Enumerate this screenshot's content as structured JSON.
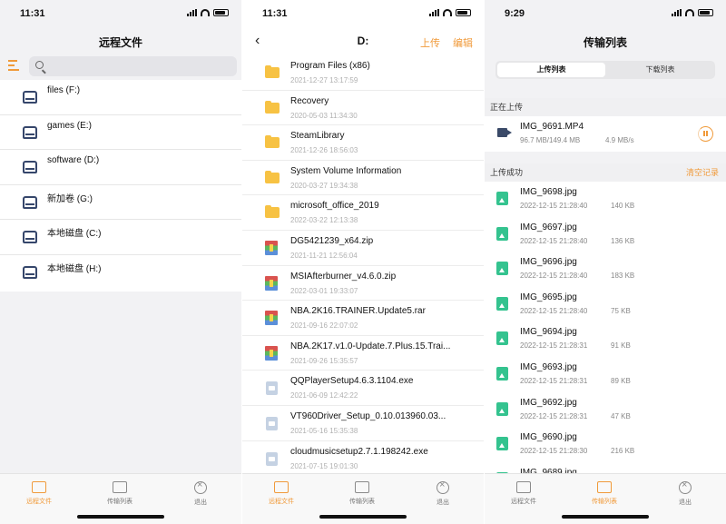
{
  "screen1": {
    "time": "11:31",
    "title": "远程文件",
    "drives": [
      {
        "label": "files (F:)"
      },
      {
        "label": "games (E:)"
      },
      {
        "label": "software (D:)"
      },
      {
        "label": "新加卷 (G:)"
      },
      {
        "label": "本地磁盘 (C:)"
      },
      {
        "label": "本地磁盘 (H:)"
      }
    ],
    "tabs": [
      "远程文件",
      "传输列表",
      "退出"
    ],
    "active_tab": "远程文件"
  },
  "screen2": {
    "time": "11:31",
    "title": "D:",
    "upload_action": "上传",
    "edit_action": "编辑",
    "files": [
      {
        "name": "Program Files (x86)",
        "date": "2021-12-27 13:17:59",
        "icon": "folder-icon"
      },
      {
        "name": "Recovery",
        "date": "2020-05-03 11:34:30",
        "icon": "folder-icon"
      },
      {
        "name": "SteamLibrary",
        "date": "2021-12-26 18:56:03",
        "icon": "folder-icon"
      },
      {
        "name": "System Volume Information",
        "date": "2020-03-27 19:34:38",
        "icon": "folder-icon"
      },
      {
        "name": "microsoft_office_2019",
        "date": "2022-03-22 12:13:38",
        "icon": "folder-icon"
      },
      {
        "name": "DG5421239_x64.zip",
        "date": "2021-11-21 12:56:04",
        "icon": "archive-icon"
      },
      {
        "name": "MSIAfterburner_v4.6.0.zip",
        "date": "2022-03-01 19:33:07",
        "icon": "archive-icon"
      },
      {
        "name": "NBA.2K16.TRAINER.Update5.rar",
        "date": "2021-09-16 22:07:02",
        "icon": "archive-icon"
      },
      {
        "name": "NBA.2K17.v1.0-Update.7.Plus.15.Trai...",
        "date": "2021-09-26 15:35:57",
        "icon": "archive-icon"
      },
      {
        "name": "QQPlayerSetup4.6.3.1104.exe",
        "date": "2021-06-09 12:42:22",
        "icon": "exe-icon"
      },
      {
        "name": "VT960Driver_Setup_0.10.013960.03...",
        "date": "2021-05-16 15:35:38",
        "icon": "exe-icon"
      },
      {
        "name": "cloudmusicsetup2.7.1.198242.exe",
        "date": "2021-07-15 19:01:30",
        "icon": "exe-icon"
      }
    ],
    "tabs": [
      "远程文件",
      "传输列表",
      "退出"
    ],
    "active_tab": "远程文件"
  },
  "screen3": {
    "time": "9:29",
    "title": "传输列表",
    "segment": [
      "上传列表",
      "下载列表"
    ],
    "active_segment": "上传列表",
    "uploading_header": "正在上传",
    "uploading": {
      "name": "IMG_9691.MP4",
      "progress_text": "96.7 MB/149.4 MB",
      "speed": "4.9 MB/s"
    },
    "done_header": "上传成功",
    "clear_action": "清空记录",
    "done": [
      {
        "name": "IMG_9698.jpg",
        "date": "2022-12-15 21:28:40",
        "size": "140 KB"
      },
      {
        "name": "IMG_9697.jpg",
        "date": "2022-12-15 21:28:40",
        "size": "136 KB"
      },
      {
        "name": "IMG_9696.jpg",
        "date": "2022-12-15 21:28:40",
        "size": "183 KB"
      },
      {
        "name": "IMG_9695.jpg",
        "date": "2022-12-15 21:28:40",
        "size": "75 KB"
      },
      {
        "name": "IMG_9694.jpg",
        "date": "2022-12-15 21:28:31",
        "size": "91 KB"
      },
      {
        "name": "IMG_9693.jpg",
        "date": "2022-12-15 21:28:31",
        "size": "89 KB"
      },
      {
        "name": "IMG_9692.jpg",
        "date": "2022-12-15 21:28:31",
        "size": "47 KB"
      },
      {
        "name": "IMG_9690.jpg",
        "date": "2022-12-15 21:28:30",
        "size": "216 KB"
      },
      {
        "name": "IMG_9689.jpg",
        "date": "",
        "size": ""
      }
    ],
    "tabs": [
      "远程文件",
      "传输列表",
      "退出"
    ],
    "active_tab": "传输列表"
  },
  "colors": {
    "accent": "#f09a3a",
    "drive_icon": "#35466b",
    "folder": "#f7c243",
    "image_file": "#34c38f"
  }
}
